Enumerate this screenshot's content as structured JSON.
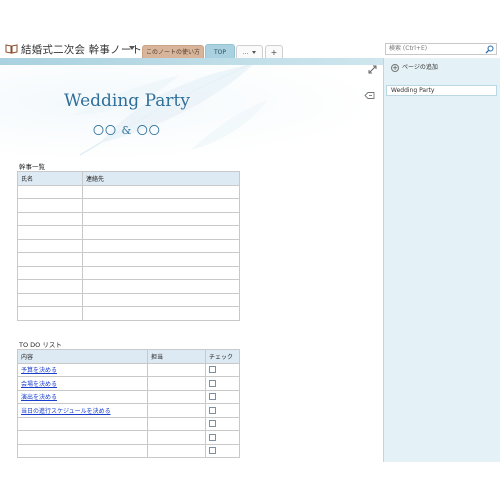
{
  "notebook": {
    "title": "結婚式二次会 幹事ノート"
  },
  "tabs": [
    {
      "label": "このノートの使い方"
    },
    {
      "label": "TOP"
    },
    {
      "label": "..."
    },
    {
      "label": "+"
    }
  ],
  "search": {
    "placeholder": "検索 (Ctrl+E)"
  },
  "page": {
    "title": "Wedding Party",
    "subtitle": "〇〇 & 〇〇",
    "staff_section": {
      "label": "幹事一覧",
      "headers": [
        "氏名",
        "連絡先"
      ]
    },
    "todo_section": {
      "label": "TO DO リスト",
      "headers": [
        "内容",
        "担当",
        "チェック"
      ],
      "items": [
        "予算を決める",
        "会場を決める",
        "演出を決める",
        "当日の進行スケジュールを決める"
      ]
    }
  },
  "right_pane": {
    "add_page": "ページの追加",
    "pages": [
      "Wedding Party"
    ]
  },
  "colors": {
    "accent": "#a9d1df",
    "title_blue": "#2f6f9a",
    "tab_orange": "#d8b59a",
    "link": "#1a3fcc"
  },
  "icons": [
    "notebook-icon",
    "chevron-down-icon",
    "search-icon",
    "expand-icon",
    "pin-icon",
    "add-circle-icon",
    "checkbox-icon"
  ]
}
